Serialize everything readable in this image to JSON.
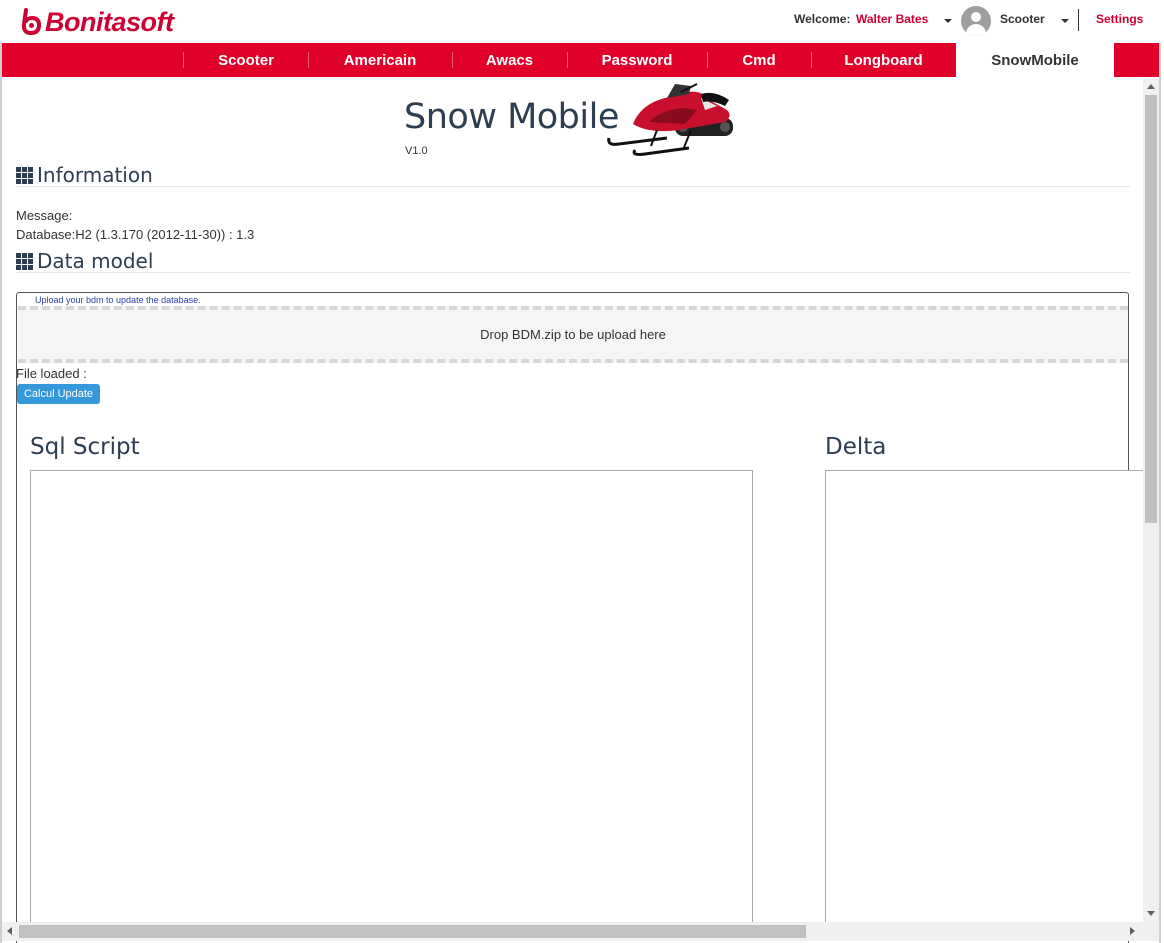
{
  "header": {
    "brand": "Bonitasoft",
    "welcome_label": "Welcome:",
    "user_name": "Walter Bates",
    "app_name": "Scooter",
    "settings_label": "Settings"
  },
  "tabs": [
    {
      "label": "Scooter"
    },
    {
      "label": "Americain"
    },
    {
      "label": "Awacs"
    },
    {
      "label": "Password"
    },
    {
      "label": "Cmd"
    },
    {
      "label": "Longboard"
    },
    {
      "label": "SnowMobile",
      "active": true
    }
  ],
  "page": {
    "title": "Snow Mobile",
    "version": "V1.0"
  },
  "information": {
    "title": "Information",
    "message": "Message:",
    "database": "Database:H2 (1.3.170 (2012-11-30)) : 1.3"
  },
  "data_model": {
    "title": "Data model",
    "upload_hint": "Upload your bdm to update the database.",
    "dropzone_label": "Drop BDM.zip to be upload here",
    "file_loaded_label": "File loaded :",
    "calc_button": "Calcul Update",
    "sql_title": "Sql Script",
    "delta_title": "Delta"
  },
  "colors": {
    "brand_red": "#e0002a",
    "heading": "#2c3e50",
    "button_blue": "#3498db"
  },
  "icons": [
    "bonitasoft-logo-icon",
    "user-avatar-icon",
    "chevron-down-icon",
    "grid-icon",
    "snowmobile-image"
  ]
}
